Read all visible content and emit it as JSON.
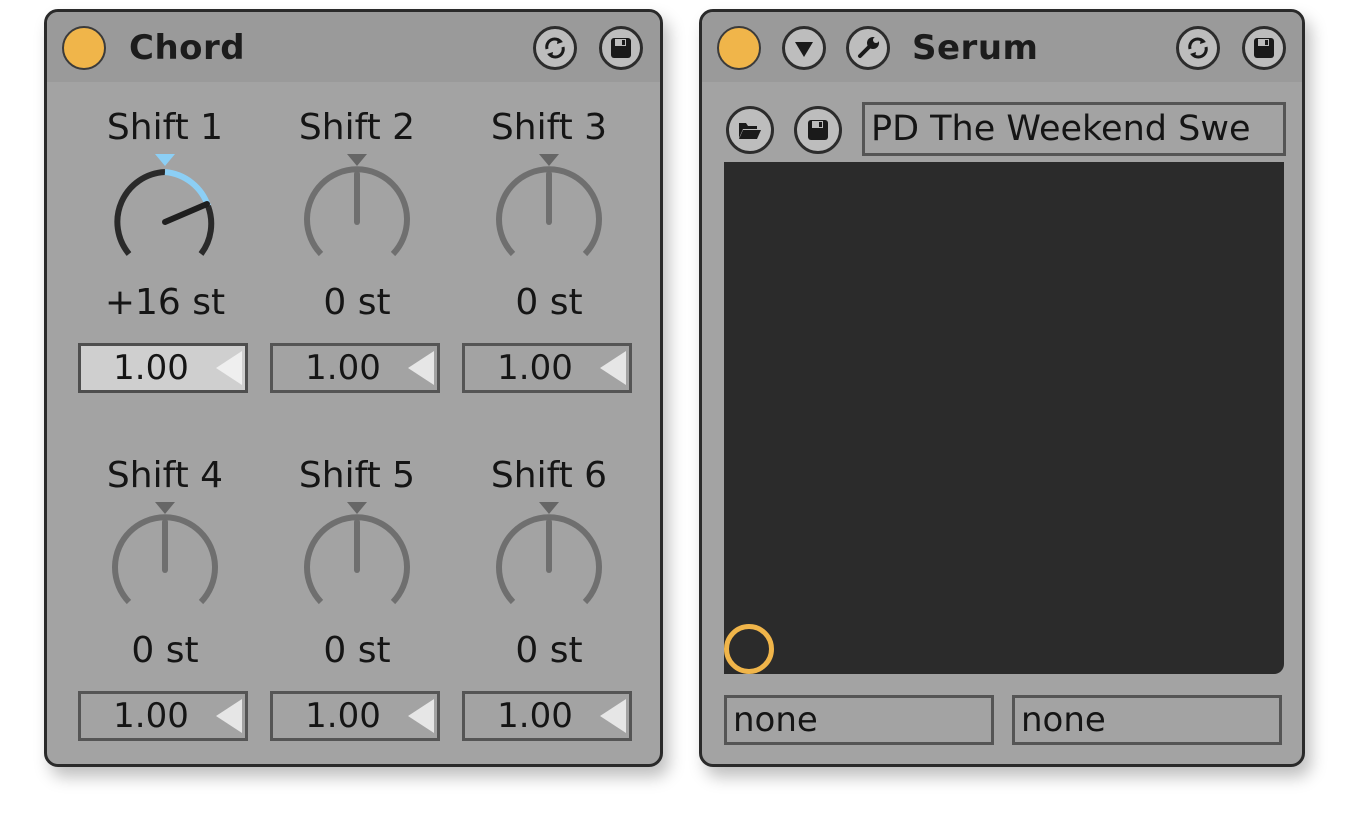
{
  "chord_device": {
    "title": "Chord",
    "knobs": [
      {
        "label": "Shift 1",
        "value": "+16 st",
        "amount": "1.00",
        "active": true
      },
      {
        "label": "Shift 2",
        "value": "0 st",
        "amount": "1.00",
        "active": false
      },
      {
        "label": "Shift 3",
        "value": "0 st",
        "amount": "1.00",
        "active": false
      },
      {
        "label": "Shift 4",
        "value": "0 st",
        "amount": "1.00",
        "active": false
      },
      {
        "label": "Shift 5",
        "value": "0 st",
        "amount": "1.00",
        "active": false
      },
      {
        "label": "Shift 6",
        "value": "0 st",
        "amount": "1.00",
        "active": false
      }
    ]
  },
  "serum_device": {
    "title": "Serum",
    "preset_name": "PD The Weekend Swe",
    "xy_x_param": "none",
    "xy_y_param": "none"
  },
  "colors": {
    "device_bg": "#a3a3a3",
    "power_on": "#f0b54a",
    "knob_active": "#8ccff5",
    "xy_bg": "#2b2b2b"
  },
  "icons": [
    "power-icon",
    "hot-swap-icon",
    "save-icon",
    "dropdown-arrow-icon",
    "wrench-icon",
    "folder-open-icon"
  ]
}
